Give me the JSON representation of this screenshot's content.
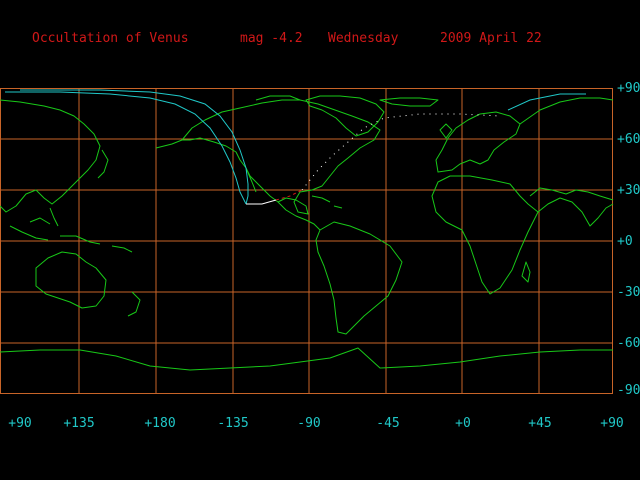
{
  "header": {
    "event": "Occultation of Venus",
    "magnitude": "mag -4.2",
    "weekday": "Wednesday",
    "date": "2009 April 22"
  },
  "lat_labels": [
    "+90",
    "+60",
    "+30",
    "+0",
    "-30",
    "-60",
    "-90"
  ],
  "lon_labels": [
    "+90",
    "+135",
    "+180",
    "-135",
    "-90",
    "-45",
    "+0",
    "+45",
    "+90"
  ],
  "colors": {
    "grid": "#c86428",
    "coast": "#18c818",
    "track_light": "#20c8c8",
    "track_day": "#ffffff",
    "track_twilight": "#d01818",
    "header": "#d01818",
    "labels": "#20c8c8"
  }
}
